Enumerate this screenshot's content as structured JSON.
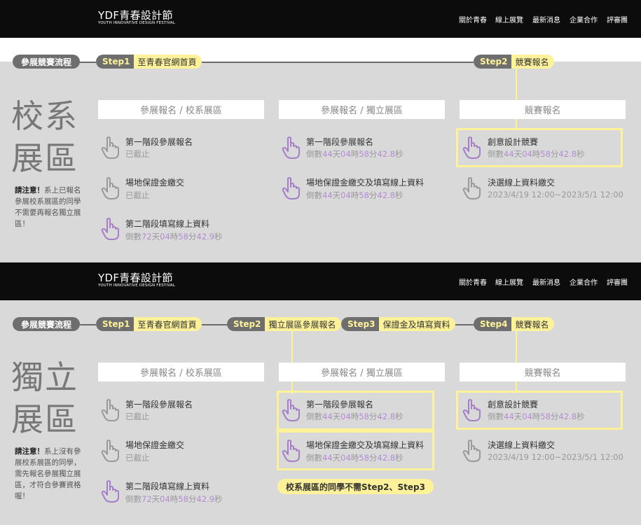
{
  "header": {
    "logo_title": "YDF青春設計節",
    "logo_subtitle": "YOUTH INNOVATIVE DESIGN FESTIVAL",
    "nav": [
      "關於青春",
      "線上展覽",
      "最新消息",
      "企業合作",
      "評審團"
    ]
  },
  "flow_label": "參展競賽流程",
  "steps": {
    "step1_num": "Step1",
    "step1_label": "至青春官網首頁",
    "step2_num": "Step2",
    "step2_label": "獨立展區參展報名",
    "step3_num": "Step3",
    "step3_label": "保證金及填寫資料",
    "step4_num": "Step4",
    "step4_label": "競賽報名"
  },
  "school": {
    "title_line1": "校系",
    "title_line2": "展區",
    "note_strong": "請注意！",
    "note_text": "系上已報名參展校系展區的同學不需要再報名獨立展區！"
  },
  "independent": {
    "title_line1": "獨立",
    "title_line2": "展區",
    "note_strong": "請注意！",
    "note_text": "系上沒有參展校系展區的同學，需先報名參展獨立展區，才符合參賽資格喔！",
    "remark": "校系展區的同學不需Step2、Step3"
  },
  "columns": {
    "school_reg": "參展報名 / 校系展區",
    "indep_reg": "參展報名 / 獨立展區",
    "competition": "競賽報名"
  },
  "items": {
    "stage1": "第一階段參展報名",
    "deposit": "場地保證金繳交",
    "deposit_full": "場地保證金繳交及填寫線上資料",
    "stage2": "第二階段填寫線上資料",
    "creative": "創意設計競賽",
    "finalist": "決選線上資料繳交",
    "closed": "已截止",
    "final_dates": "2023/4/19 12:00~2023/5/1 12:00"
  },
  "countdown": {
    "prefix": "倒數",
    "a_days": "44",
    "a_hours": "04",
    "a_mins": "58",
    "a_secs": "42.8",
    "b_days": "72",
    "b_hours": "04",
    "b_mins": "58",
    "b_secs": "42.9",
    "u_day": "天",
    "u_hour": "時",
    "u_min": "分",
    "u_sec": "秒"
  },
  "colors": {
    "accent_yellow": "#fdf29a",
    "countdown_purple": "#b48ad6",
    "pill_gray": "#6e6e6e"
  }
}
